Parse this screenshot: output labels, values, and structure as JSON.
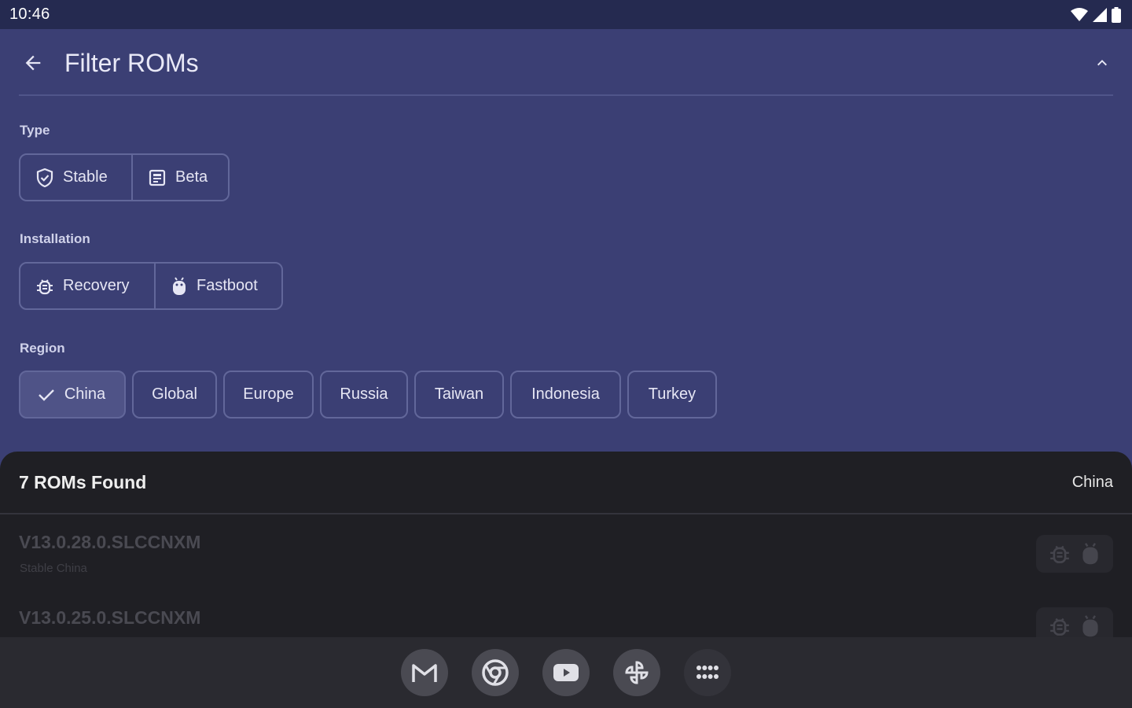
{
  "status_bar": {
    "time": "10:46"
  },
  "header": {
    "title": "Filter ROMs"
  },
  "filters": {
    "type": {
      "label": "Type",
      "options": [
        "Stable",
        "Beta"
      ]
    },
    "installation": {
      "label": "Installation",
      "options": [
        "Recovery",
        "Fastboot"
      ]
    },
    "region": {
      "label": "Region",
      "selected": "China",
      "options": [
        "China",
        "Global",
        "Europe",
        "Russia",
        "Taiwan",
        "Indonesia",
        "Turkey"
      ]
    }
  },
  "results": {
    "count_label": "7 ROMs Found",
    "region": "China",
    "roms": [
      {
        "version": "V13.0.28.0.SLCCNXM",
        "subtitle": "Stable China"
      },
      {
        "version": "V13.0.25.0.SLCCNXM",
        "subtitle": ""
      }
    ]
  },
  "dock": {
    "apps": [
      "gmail-icon",
      "chrome-icon",
      "youtube-icon",
      "pinwheel-icon",
      "app-drawer-icon"
    ]
  },
  "colors": {
    "background": "#3b3f74",
    "status_bar": "#252a50",
    "sheet": "#1f1f24",
    "nav_bar": "#2a2a30",
    "outline": "#62679a",
    "selected_chip": "#4f5387"
  }
}
